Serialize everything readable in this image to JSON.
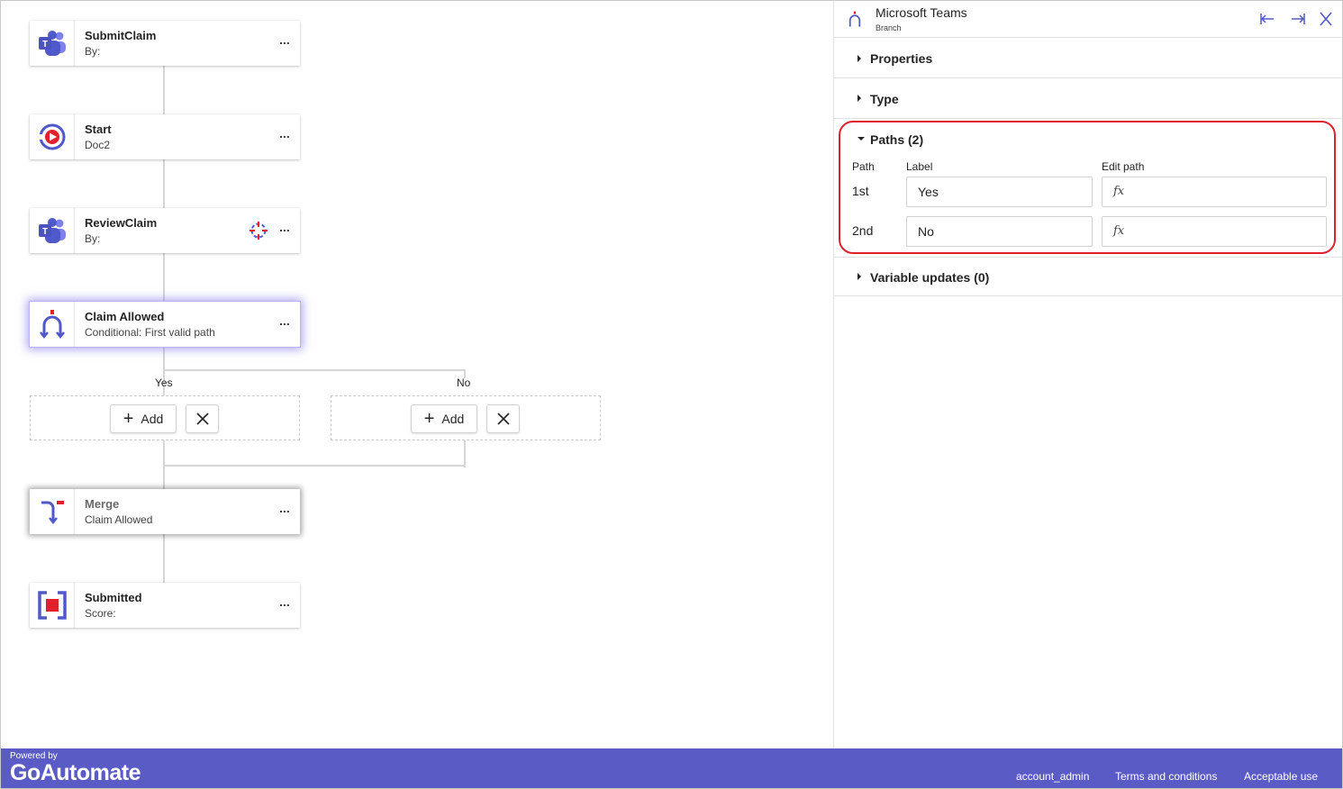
{
  "colors": {
    "accent": "#5b5bc6",
    "teams": "#5059c9",
    "red": "#e0202a"
  },
  "flow": {
    "nodes": [
      {
        "title": "SubmitClaim",
        "subtitle": "By:",
        "icon": "teams-icon"
      },
      {
        "title": "Start",
        "subtitle": "Doc2",
        "icon": "play-circle-icon"
      },
      {
        "title": "ReviewClaim",
        "subtitle": "By:",
        "icon": "teams-icon"
      },
      {
        "title": "Claim Allowed",
        "subtitle": "Conditional: First valid path",
        "icon": "branch-icon"
      },
      {
        "title": "Merge",
        "subtitle": "Claim Allowed",
        "icon": "merge-icon"
      },
      {
        "title": "Submitted",
        "subtitle": "Score:",
        "icon": "stop-icon"
      }
    ],
    "more_label": "...",
    "branches": [
      {
        "label": "Yes",
        "add_label": "Add"
      },
      {
        "label": "No",
        "add_label": "Add"
      }
    ]
  },
  "panel": {
    "title": "Microsoft Teams",
    "subtitle": "Branch",
    "sections": {
      "properties": "Properties",
      "type": "Type",
      "paths": "Paths (2)",
      "variable_updates": "Variable updates (0)"
    },
    "paths_table": {
      "headers": {
        "path": "Path",
        "label": "Label",
        "edit_path": "Edit path"
      },
      "rows": [
        {
          "path": "1st",
          "label": "Yes",
          "edit": "fx"
        },
        {
          "path": "2nd",
          "label": "No",
          "edit": "fx"
        }
      ]
    }
  },
  "footer": {
    "powered_by": "Powered by",
    "brand": "GoAutomate",
    "links": [
      "account_admin",
      "Terms and conditions",
      "Acceptable use"
    ]
  }
}
